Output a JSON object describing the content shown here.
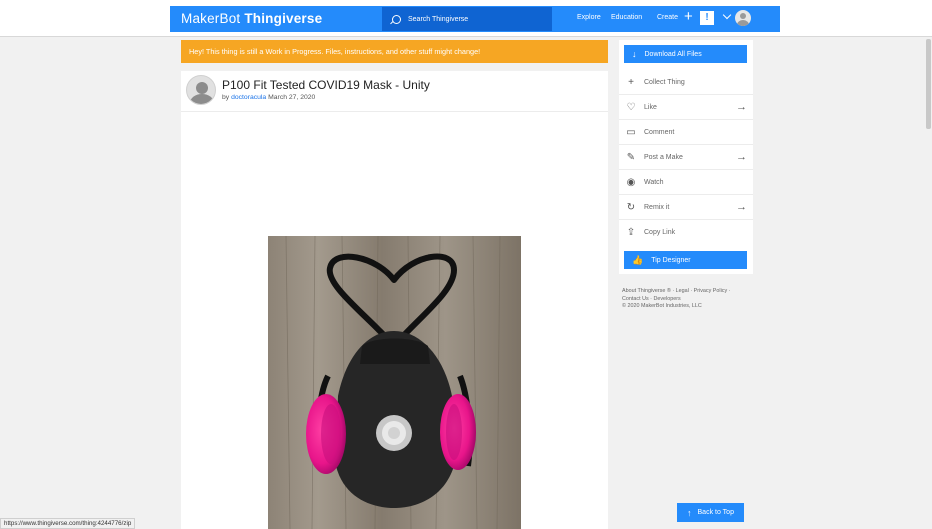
{
  "header": {
    "logo_makerbot": "MakerBot",
    "logo_thingiverse": "Thingiverse",
    "search_placeholder": "Search Thingiverse",
    "nav_explore": "Explore",
    "nav_education": "Education",
    "nav_create": "Create",
    "plus_glyph": "+",
    "notif_glyph": "!"
  },
  "banner": {
    "text": "Hey! This thing is still a Work in Progress. Files, instructions, and other stuff might change!"
  },
  "thing": {
    "title": "P100 Fit Tested COVID19 Mask - Unity",
    "by": "by",
    "author": "doctoracula",
    "date": "March 27, 2020"
  },
  "sidebar": {
    "download": "Download All Files",
    "collect": "Collect Thing",
    "like": "Like",
    "comment": "Comment",
    "post_make": "Post a Make",
    "watch": "Watch",
    "remix": "Remix it",
    "copy_link": "Copy Link",
    "tip": "Tip Designer"
  },
  "footer": {
    "about": "About Thingiverse ®",
    "legal": "Legal",
    "privacy": "Privacy Policy",
    "contact": "Contact Us",
    "developers": "Developers",
    "copyright": "© 2020 MakerBot Industries, LLC"
  },
  "back_to_top": "Back to Top",
  "status_url": "https://www.thingiverse.com/thing:4244776/zip",
  "colors": {
    "brand_blue": "#248bfb",
    "search_blue": "#0f64d2",
    "warning_orange": "#f6a623"
  }
}
